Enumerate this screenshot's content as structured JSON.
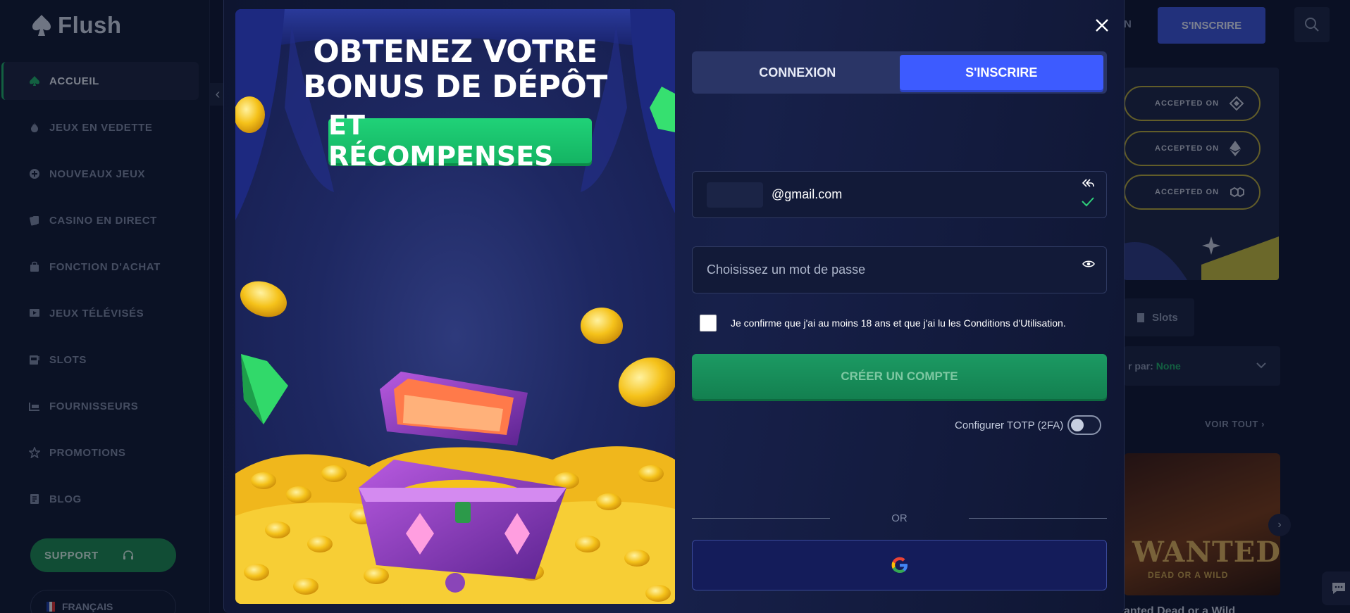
{
  "app": {
    "logo_text": "Flush"
  },
  "sidebar": {
    "items": [
      {
        "label": "ACCUEIL",
        "icon": "spade-icon",
        "active": true
      },
      {
        "label": "JEUX EN VEDETTE",
        "icon": "fire-icon"
      },
      {
        "label": "NOUVEAUX JEUX",
        "icon": "plus-circle-icon"
      },
      {
        "label": "CASINO EN DIRECT",
        "icon": "cards-icon"
      },
      {
        "label": "FONCTION D'ACHAT",
        "icon": "shopping-bag-icon"
      },
      {
        "label": "JEUX TÉLÉVISÉS",
        "icon": "tv-icon"
      },
      {
        "label": "SLOTS",
        "icon": "slot-machine-icon"
      },
      {
        "label": "FOURNISSEURS",
        "icon": "provider-icon"
      },
      {
        "label": "PROMOTIONS",
        "icon": "star-icon"
      },
      {
        "label": "BLOG",
        "icon": "document-icon"
      }
    ],
    "support_label": "SUPPORT",
    "language_label": "FRANÇAIS"
  },
  "topbar": {
    "partial_text": "N",
    "signup_label": "S'INSCRIRE"
  },
  "background": {
    "accepted_label": "ACCEPTED ON",
    "slots_label": "Slots",
    "sort_label": "r par:",
    "sort_value": "None",
    "view_all": "VOIR TOUT",
    "game_title": "anted Dead or a Wild",
    "game_art_title": "WANTED",
    "game_art_sub": "DEAD OR A WILD"
  },
  "modal": {
    "banner": {
      "title_line1": "OBTENEZ VOTRE",
      "title_line2": "BONUS DE DÉPÔT",
      "badge": "ET RÉCOMPENSES"
    },
    "tabs": [
      {
        "label": "CONNEXION",
        "active": false
      },
      {
        "label": "S'INSCRIRE",
        "active": true
      }
    ],
    "email": {
      "value": "@gmail.com"
    },
    "password": {
      "placeholder": "Choisissez un mot de passe",
      "value": ""
    },
    "terms_text": "Je confirme que j'ai au moins 18 ans et que j'ai lu les Conditions d'Utilisation.",
    "terms_checked": false,
    "create_button": "CRÉER UN COMPTE",
    "totp_label": "Configurer TOTP (2FA)",
    "totp_enabled": false,
    "or_text": "OR",
    "google_icon": "google-icon"
  },
  "colors": {
    "accent_blue": "#3d5bff",
    "accent_green": "#1fae69",
    "background": "#0f1630"
  }
}
